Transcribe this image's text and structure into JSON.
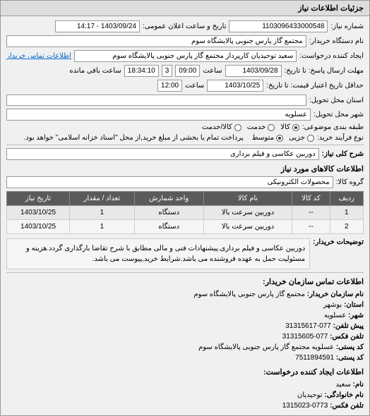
{
  "panel_title": "جزئیات اطلاعات نیاز",
  "form": {
    "number_label": "شماره نیاز:",
    "number_value": "1103096433000548",
    "announce_label": "تاریخ و ساعت اعلان عمومی:",
    "announce_value": "1403/09/24 - 14:17",
    "buyer_label": "نام دستگاه خریدار:",
    "buyer_value": "مجتمع گاز پارس جنوبی  پالایشگاه سوم",
    "creator_label": "ایجاد کننده درخواست:",
    "creator_value": "سعید توحیدیان کارپرداز مجتمع گاز پارس جنوبی  پالایشگاه سوم",
    "buyer_contact_link": "اطلاعات تماس خریدار",
    "deadline_label": "مهلت ارسال پاسخ: تا تاریخ:",
    "deadline_date": "1403/09/28",
    "deadline_time_label": "ساعت",
    "deadline_time": "09:00",
    "remaining_days": "3",
    "remaining_time": "18:34:10",
    "remaining_label": "ساعت باقی مانده",
    "delivery_label": "حداقل تاریخ اعتبار قیمت: تا تاریخ:",
    "delivery_date": "1403/10/25",
    "delivery_time_label": "ساعت",
    "delivery_time": "12:00",
    "province_label": "استان محل تحویل:",
    "province_value": "",
    "city_label": "شهر محل تحویل:",
    "city_value": "عسلویه",
    "subject_type_label": "طبقه بندی موضوعی:",
    "subject_kala": "کالا",
    "subject_service": "خدمت",
    "subject_both": "کالا/خدمت",
    "process_label": "نوع فرآیند خرید:",
    "process_low": "جزیی",
    "process_mid": "متوسط",
    "process_note": "پرداخت تمام یا بخشی از مبلغ خرید,از محل \"اسناد خزانه اسلامی\" خواهد بود.",
    "need_title_label": "شرح کلی نیاز:",
    "need_title_value": "دوربین عکاسی و فیلم برداری"
  },
  "goods_header": "اطلاعات کالاهای مورد نیاز",
  "group_label": "گروه کالا:",
  "group_value": "محصولات الکترونیکی",
  "table": {
    "cols": [
      "ردیف",
      "کد کالا",
      "نام کالا",
      "واحد شمارش",
      "تعداد / مقدار",
      "تاریخ نیاز"
    ],
    "rows": [
      [
        "1",
        "--",
        "دوربین سرعت بالا",
        "دستگاه",
        "1",
        "1403/10/25"
      ],
      [
        "2",
        "--",
        "دوربین سرعت بالا",
        "دستگاه",
        "1",
        "1403/10/25"
      ]
    ]
  },
  "desc_label": "توضیحات خریدار:",
  "desc_value": "دوربین عکاسی و فیلم برداری.پیشنهادات فنی و مالی مطابق با شرح تقاضا بارگذاری گردد.هزینه و مسئولیت حمل به عهده فروشنده می باشد.شرایط خرید,پیوست می باشد.",
  "contact": {
    "header": "اطلاعات تماس سازمان خریدار:",
    "org_label": "نام سازمان خریدار:",
    "org_value": "مجتمع گاز پارس جنوبی پالایشگاه سوم",
    "province_label": "استان:",
    "province_value": "بوشهر",
    "city_label": "شهر:",
    "city_value": "عسلویه",
    "pre_phone_label": "پیش تلفن:",
    "pre_phone_value": "077-31315617",
    "fax_label": "تلفن فکس:",
    "fax_value": "077-31315605",
    "post_label": "کد پستی:",
    "post_value": "عسلویه مجتمع گاز پارس جنوبی پالایشگاه سوم",
    "postcode_label": "کد پستی:",
    "postcode_value": "7511894591",
    "creator_header": "اطلاعات ایجاد کننده درخواست:",
    "fname_label": "نام:",
    "fname_value": "سعید",
    "lname_label": "نام خانوادگی:",
    "lname_value": "توحیدیان",
    "phone_label": "تلفن فکس:",
    "phone_value": "0773-1315023"
  }
}
